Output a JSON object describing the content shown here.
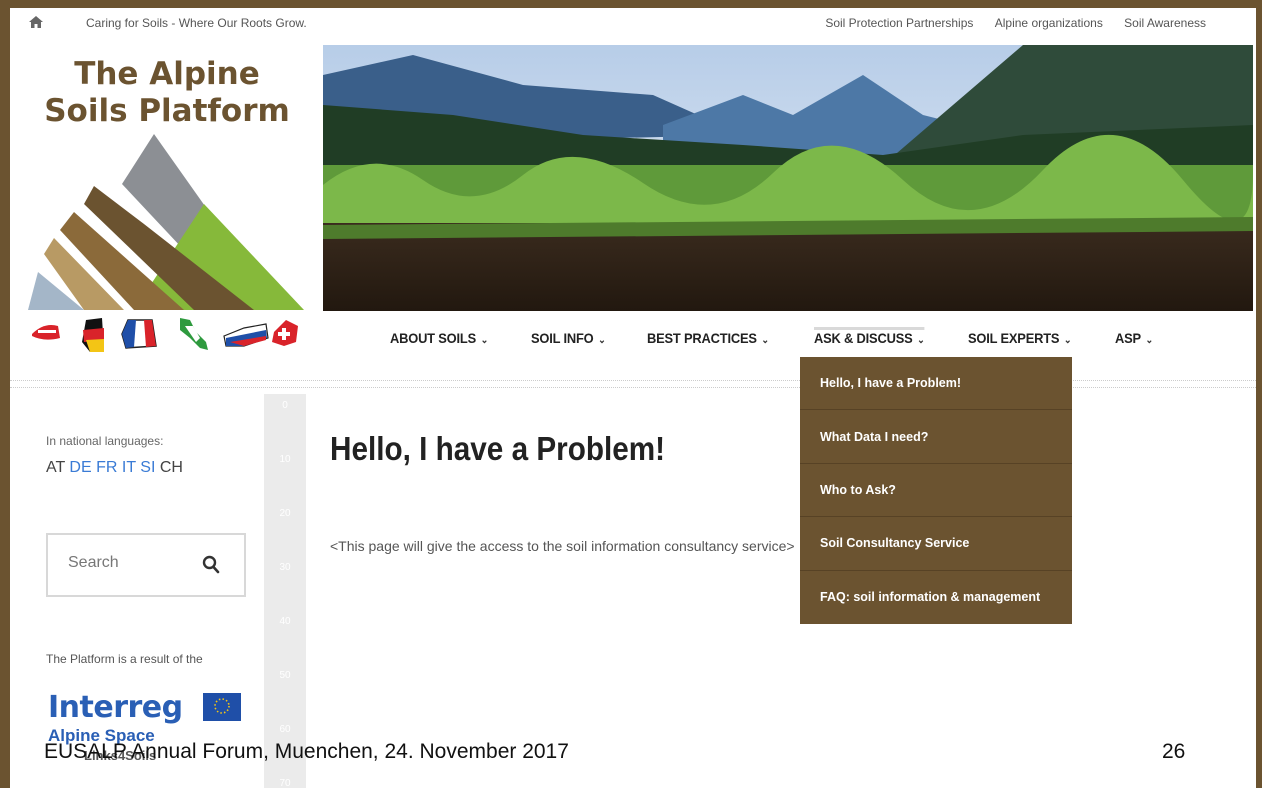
{
  "topbar": {
    "tagline": "Caring for Soils - Where Our Roots Grow.",
    "links": [
      "Soil Protection Partnerships",
      "Alpine organizations",
      "Soil Awareness"
    ]
  },
  "logo": {
    "title_line1": "The Alpine",
    "title_line2": "Soils Platform"
  },
  "nav": {
    "items": [
      {
        "label": "ABOUT SOILS"
      },
      {
        "label": "SOIL INFO"
      },
      {
        "label": "BEST PRACTICES"
      },
      {
        "label": "ASK & DISCUSS"
      },
      {
        "label": "SOIL EXPERTS"
      },
      {
        "label": "ASP"
      }
    ],
    "active": "ASK & DISCUSS"
  },
  "dropdown": {
    "items": [
      "Hello, I have a Problem!",
      "What Data I need?",
      "Who to Ask?",
      "Soil Consultancy Service",
      "FAQ: soil information & management"
    ]
  },
  "sidebar": {
    "lang_label": "In national languages:",
    "langs": [
      "AT",
      "DE",
      "FR",
      "IT",
      "SI",
      "CH"
    ],
    "search_placeholder": "Search",
    "platform_text": "The Platform is a result of the",
    "interreg": "Interreg",
    "alpine_space": "Alpine Space",
    "links4soils": "Links4Soils"
  },
  "ruler": {
    "ticks": [
      "0",
      "10",
      "20",
      "30",
      "40",
      "50",
      "60",
      "70"
    ]
  },
  "content": {
    "title": "Hello, I have a Problem!",
    "text": "<This page will give the access to the soil information consultancy service>"
  },
  "footer": {
    "left": "EUSALP Annual Forum, Muenchen, 24. November 2017",
    "page_number": "26"
  },
  "colors": {
    "brand_brown": "#6b5330",
    "link_blue": "#3a7bd5",
    "interreg_blue": "#2a5fb5"
  }
}
